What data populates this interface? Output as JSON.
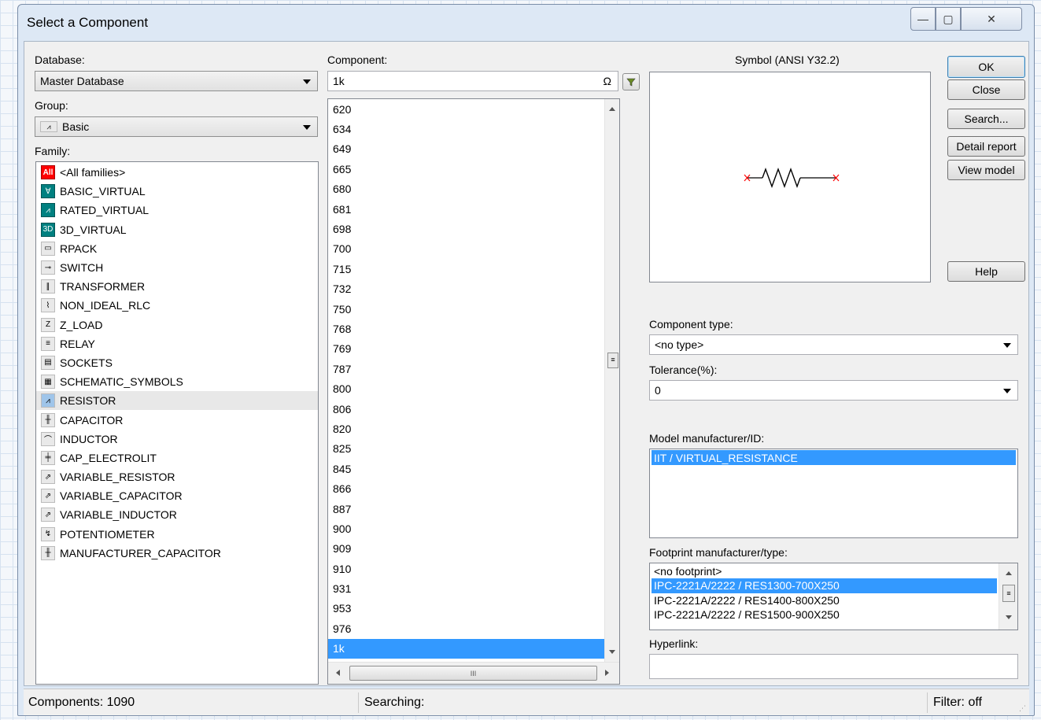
{
  "window": {
    "title": "Select a Component",
    "controls": {
      "minimize": "—",
      "maximize": "▢",
      "close": "✕"
    }
  },
  "database": {
    "label": "Database:",
    "value": "Master Database"
  },
  "group": {
    "label": "Group:",
    "value": "Basic"
  },
  "family": {
    "label": "Family:",
    "items": [
      {
        "label": "<All families>",
        "icon": "all-families-icon",
        "glyph": "All"
      },
      {
        "label": "BASIC_VIRTUAL",
        "icon": "basic-virtual-icon",
        "glyph": "∀"
      },
      {
        "label": "RATED_VIRTUAL",
        "icon": "rated-virtual-icon",
        "glyph": "⩘"
      },
      {
        "label": "3D_VIRTUAL",
        "icon": "3d-virtual-icon",
        "glyph": "3D"
      },
      {
        "label": "RPACK",
        "icon": "rpack-icon",
        "glyph": "▭"
      },
      {
        "label": "SWITCH",
        "icon": "switch-icon",
        "glyph": "⊸"
      },
      {
        "label": "TRANSFORMER",
        "icon": "transformer-icon",
        "glyph": "∥"
      },
      {
        "label": "NON_IDEAL_RLC",
        "icon": "non-ideal-rlc-icon",
        "glyph": "⌇"
      },
      {
        "label": "Z_LOAD",
        "icon": "z-load-icon",
        "glyph": "Z"
      },
      {
        "label": "RELAY",
        "icon": "relay-icon",
        "glyph": "≡"
      },
      {
        "label": "SOCKETS",
        "icon": "sockets-icon",
        "glyph": "▤"
      },
      {
        "label": "SCHEMATIC_SYMBOLS",
        "icon": "schematic-symbols-icon",
        "glyph": "▦"
      },
      {
        "label": "RESISTOR",
        "icon": "resistor-icon",
        "glyph": "⩘"
      },
      {
        "label": "CAPACITOR",
        "icon": "capacitor-icon",
        "glyph": "╫"
      },
      {
        "label": "INDUCTOR",
        "icon": "inductor-icon",
        "glyph": "⌒"
      },
      {
        "label": "CAP_ELECTROLIT",
        "icon": "cap-electrolit-icon",
        "glyph": "╪"
      },
      {
        "label": "VARIABLE_RESISTOR",
        "icon": "variable-resistor-icon",
        "glyph": "⇗"
      },
      {
        "label": "VARIABLE_CAPACITOR",
        "icon": "variable-capacitor-icon",
        "glyph": "⇗"
      },
      {
        "label": "VARIABLE_INDUCTOR",
        "icon": "variable-inductor-icon",
        "glyph": "⇗"
      },
      {
        "label": "POTENTIOMETER",
        "icon": "potentiometer-icon",
        "glyph": "↯"
      },
      {
        "label": "MANUFACTURER_CAPACITOR",
        "icon": "manufacturer-capacitor-icon",
        "glyph": "╫"
      }
    ],
    "selected_index": 12
  },
  "component": {
    "label": "Component:",
    "search_value": "1k",
    "omega": "Ω",
    "items": [
      "620",
      "634",
      "649",
      "665",
      "680",
      "681",
      "698",
      "700",
      "715",
      "732",
      "750",
      "768",
      "769",
      "787",
      "800",
      "806",
      "820",
      "825",
      "845",
      "866",
      "887",
      "900",
      "909",
      "910",
      "931",
      "953",
      "976",
      "1k"
    ],
    "selected_index": 27,
    "hscroll_grip": "III"
  },
  "symbol": {
    "label": "Symbol (ANSI Y32.2)"
  },
  "buttons": {
    "ok": "OK",
    "close": "Close",
    "search": "Search...",
    "detail_report": "Detail report",
    "view_model": "View model",
    "help": "Help"
  },
  "component_type": {
    "label": "Component type:",
    "value": "<no type>"
  },
  "tolerance": {
    "label": "Tolerance(%):",
    "value": "0"
  },
  "model_manufacturer": {
    "label": "Model manufacturer/ID:",
    "items": [
      "IIT / VIRTUAL_RESISTANCE"
    ]
  },
  "footprint": {
    "label": "Footprint manufacturer/type:",
    "items": [
      "<no footprint>",
      "IPC-2221A/2222 / RES1300-700X250",
      "IPC-2221A/2222 / RES1400-800X250",
      "IPC-2221A/2222 / RES1500-900X250"
    ],
    "selected_index": 1
  },
  "hyperlink": {
    "label": "Hyperlink:",
    "value": ""
  },
  "status": {
    "components": "Components: 1090",
    "searching": "Searching:",
    "filter": "Filter: off"
  },
  "colors": {
    "selection": "#3399ff",
    "resistor_line": "#000000",
    "pin_marker": "#ff0000",
    "all_icon": "#ff0000",
    "virtual_icon": "#008080"
  }
}
